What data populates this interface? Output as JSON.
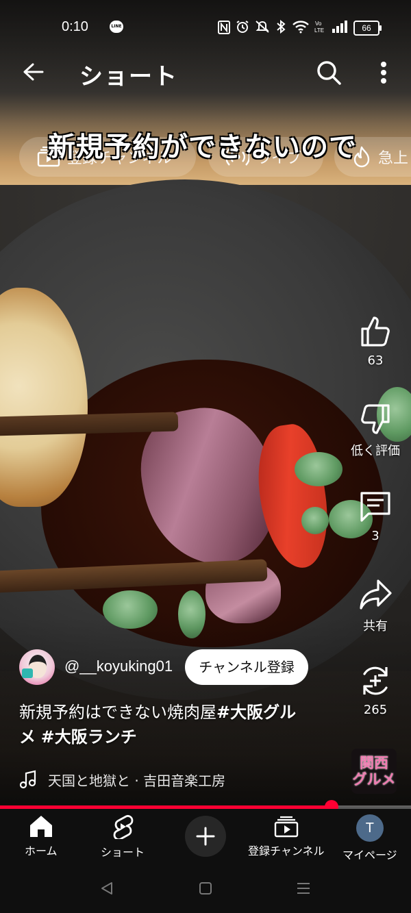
{
  "status_bar": {
    "time": "0:10",
    "line_label": "LINE",
    "battery": "66",
    "icons": [
      "nfc-icon",
      "alarm-icon",
      "mute-icon",
      "bluetooth-icon",
      "wifi-icon",
      "volte-icon",
      "signal-icon",
      "battery-icon"
    ]
  },
  "header": {
    "title": "ショート",
    "icons": [
      "back-arrow-icon",
      "search-icon",
      "more-vert-icon"
    ]
  },
  "chips": [
    {
      "label": "登録チャンネル",
      "icon": "subscriptions-icon"
    },
    {
      "label": "ライブ",
      "icon": "live-icon"
    },
    {
      "label": "急上",
      "icon": "trending-icon"
    }
  ],
  "video": {
    "caption": "新規予約ができないので"
  },
  "actions": {
    "like_count": "63",
    "dislike_label": "低く評価",
    "comments_count": "3",
    "share_label": "共有",
    "remix_count": "265"
  },
  "channel": {
    "name": "@__koyuking01",
    "subscribe_label": "チャンネル登録"
  },
  "description": {
    "text": "新規予約はできない焼肉屋",
    "tag1": "#大阪グル",
    "line2_tag1": "メ",
    "line2_tag2": "#大阪ランチ"
  },
  "music": {
    "text": "天国と地獄と · 吉田音楽工房"
  },
  "logo": {
    "line1": "関西",
    "line2": "グルメ"
  },
  "progress": {
    "played_fraction": 0.807,
    "color": "#ff0033"
  },
  "bottom_nav": {
    "home": "ホーム",
    "shorts": "ショート",
    "subscriptions": "登録チャンネル",
    "mypage": "マイページ",
    "avatar_initial": "T"
  }
}
